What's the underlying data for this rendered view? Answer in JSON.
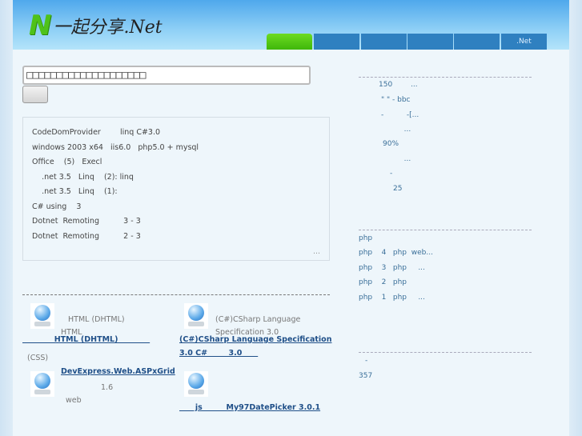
{
  "header": {
    "logo_text": "一起分享.Net",
    "nav": [
      "",
      "",
      "",
      "",
      "",
      ".Net"
    ]
  },
  "search": {
    "placeholder": "□□□□□□□□□□□□□□□□□□□□"
  },
  "articles": [
    "CodeDomProvider        linq C#3.0",
    "windows 2003 x64   iis6.0   php5.0 + mysql",
    "Office    (5)   Execl",
    "    .net 3.5   Linq    (2): linq",
    "    .net 3.5   Linq    (1):",
    "C# using    3",
    "Dotnet  Remoting          3 - 3",
    "Dotnet  Remoting          2 - 3"
  ],
  "more": "...",
  "downloads": [
    {
      "desc1": "HTML (DHTML)",
      "desc2": "HTML",
      "link": "            HTML (DHTML)            "
    },
    {
      "desc1": "(C#)CSharp Language",
      "desc2": "Specification 3.0",
      "link": "(C#)CSharp Language Specification",
      "link2": "3.0 C#        3.0      "
    },
    {
      "desc1": "(CSS)",
      "link": "DevExpress.Web.ASPxGrid",
      "desc2": "1.6",
      "desc3": "web"
    },
    {
      "link": "      js         My97DatePicker 3.0.1"
    }
  ],
  "news": [
    "150        ...",
    "\" \" - bbc",
    "-          -[...",
    "          ...",
    "90%",
    "          ...",
    "-",
    "25"
  ],
  "php": [
    "php",
    "php    4   php  web...",
    "php    3   php     ...",
    "php    2   php",
    "php    1   php     ..."
  ],
  "stats": [
    "-",
    "357"
  ]
}
